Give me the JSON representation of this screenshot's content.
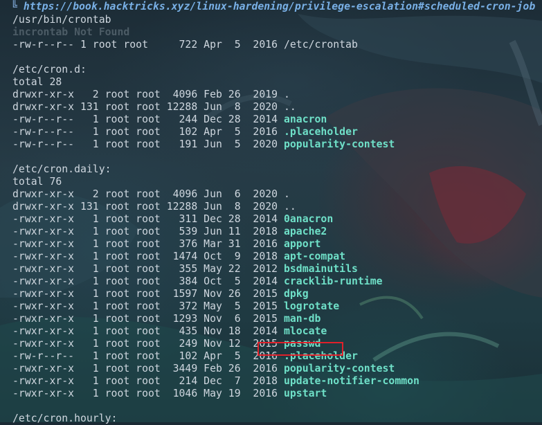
{
  "url_line": {
    "corner_glyph": "╚",
    "url": "https://book.hacktricks.xyz/linux-hardening/privilege-escalation#scheduled-cron-job"
  },
  "lines_top": [
    {
      "text": "/usr/bin/crontab",
      "style": "plain"
    },
    {
      "text": "incrontab Not Found",
      "style": "dim"
    },
    {
      "text": "-rw-r--r-- 1 root root     722 Apr  5  2016 /etc/crontab",
      "style": "plain"
    },
    {
      "text": "",
      "style": "plain"
    },
    {
      "text": "/etc/cron.d:",
      "style": "plain"
    },
    {
      "text": "total 28",
      "style": "plain"
    }
  ],
  "cron_d": [
    {
      "meta": "drwxr-xr-x   2 root root  4096 Feb 26  2019 ",
      "name": ".",
      "highlight": false
    },
    {
      "meta": "drwxr-xr-x 131 root root 12288 Jun  8  2020 ",
      "name": "..",
      "highlight": false
    },
    {
      "meta": "-rw-r--r--   1 root root   244 Dec 28  2014 ",
      "name": "anacron",
      "highlight": true
    },
    {
      "meta": "-rw-r--r--   1 root root   102 Apr  5  2016 ",
      "name": ".placeholder",
      "highlight": true
    },
    {
      "meta": "-rw-r--r--   1 root root   191 Jun  5  2020 ",
      "name": "popularity-contest",
      "highlight": true
    }
  ],
  "cron_daily_header": [
    {
      "text": "",
      "style": "plain"
    },
    {
      "text": "/etc/cron.daily:",
      "style": "plain"
    },
    {
      "text": "total 76",
      "style": "plain"
    }
  ],
  "cron_daily": [
    {
      "meta": "drwxr-xr-x   2 root root  4096 Jun  6  2020 ",
      "name": ".",
      "highlight": false
    },
    {
      "meta": "drwxr-xr-x 131 root root 12288 Jun  8  2020 ",
      "name": "..",
      "highlight": false
    },
    {
      "meta": "-rwxr-xr-x   1 root root   311 Dec 28  2014 ",
      "name": "0anacron",
      "highlight": true
    },
    {
      "meta": "-rwxr-xr-x   1 root root   539 Jun 11  2018 ",
      "name": "apache2",
      "highlight": true
    },
    {
      "meta": "-rwxr-xr-x   1 root root   376 Mar 31  2016 ",
      "name": "apport",
      "highlight": true
    },
    {
      "meta": "-rwxr-xr-x   1 root root  1474 Oct  9  2018 ",
      "name": "apt-compat",
      "highlight": true
    },
    {
      "meta": "-rwxr-xr-x   1 root root   355 May 22  2012 ",
      "name": "bsdmainutils",
      "highlight": true
    },
    {
      "meta": "-rwxr-xr-x   1 root root   384 Oct  5  2014 ",
      "name": "cracklib-runtime",
      "highlight": true
    },
    {
      "meta": "-rwxr-xr-x   1 root root  1597 Nov 26  2015 ",
      "name": "dpkg",
      "highlight": true
    },
    {
      "meta": "-rwxr-xr-x   1 root root   372 May  5  2015 ",
      "name": "logrotate",
      "highlight": true
    },
    {
      "meta": "-rwxr-xr-x   1 root root  1293 Nov  6  2015 ",
      "name": "man-db",
      "highlight": true
    },
    {
      "meta": "-rwxr-xr-x   1 root root   435 Nov 18  2014 ",
      "name": "mlocate",
      "highlight": true
    },
    {
      "meta": "-rwxr-xr-x   1 root root   249 Nov 12  2015 ",
      "name": "passwd",
      "highlight": true
    },
    {
      "meta": "-rw-r--r--   1 root root   102 Apr  5  2016 ",
      "name": ".placeholder",
      "highlight": true
    },
    {
      "meta": "-rwxr-xr-x   1 root root  3449 Feb 26  2016 ",
      "name": "popularity-contest",
      "highlight": true
    },
    {
      "meta": "-rwxr-xr-x   1 root root   214 Dec  7  2018 ",
      "name": "update-notifier-common",
      "highlight": true
    },
    {
      "meta": "-rwxr-xr-x   1 root root  1046 May 19  2016 ",
      "name": "upstart",
      "highlight": true
    }
  ],
  "lines_bottom": [
    {
      "text": "",
      "style": "plain"
    },
    {
      "text": "/etc/cron.hourly:",
      "style": "plain"
    }
  ],
  "annotation": {
    "color": "#e0202a",
    "target": "passwd"
  }
}
